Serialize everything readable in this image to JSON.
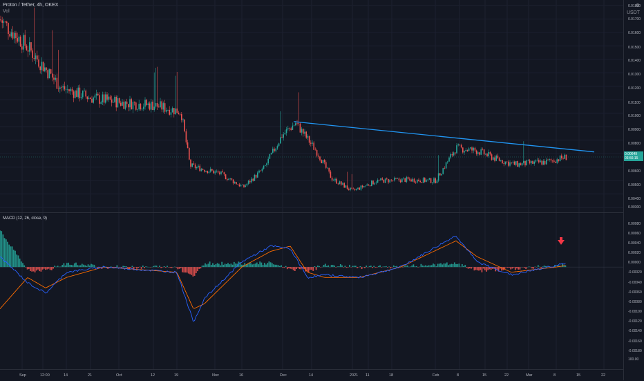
{
  "header": {
    "symbol": "Proton / Tether, 4h, OKEX",
    "vol_label": "Vol"
  },
  "corner_icons": [
    "settings-icon",
    "currency-label"
  ],
  "currency_label": "USDT",
  "macd": {
    "label": "MACD (12, 26, close, 9)"
  },
  "price_axis": {
    "ticks": [
      "0.01800",
      "0.01700",
      "0.01600",
      "0.01500",
      "0.01400",
      "0.01300",
      "0.01200",
      "0.01100",
      "0.01000",
      "0.00900",
      "0.00800",
      "0.00700",
      "0.00600",
      "0.00500",
      "0.00400",
      "0.00300"
    ],
    "last_price": "0.00649",
    "countdown": "03:56:15"
  },
  "macd_axis": {
    "ticks": [
      "0.00080",
      "0.00060",
      "0.00040",
      "0.00020",
      "0.00000",
      "-0.00020",
      "-0.00040",
      "-0.00060",
      "-0.00080",
      "-0.00100",
      "-0.00120",
      "-0.00140",
      "-0.00160",
      "-0.00180",
      "100.00"
    ]
  },
  "time_axis": {
    "ticks": [
      "Sep",
      "12:00",
      "14",
      "21",
      "Oct",
      "12",
      "19",
      "Nov",
      "16",
      "Dec",
      "14",
      "2021",
      "11",
      "18",
      "Feb",
      "8",
      "15",
      "22",
      "Mar",
      "8",
      "15",
      "22"
    ]
  },
  "colors": {
    "background": "#131722",
    "up": "#26a69a",
    "down": "#ef5350",
    "trendline": "#2196f3",
    "macd_line": "#2962ff",
    "signal_line": "#ff6d00",
    "arrow": "#f23645"
  },
  "chart_data": {
    "type": "candlestick",
    "title": "Proton / Tether, 4h, OKEX",
    "price_range": [
      0.0025,
      0.0185
    ],
    "price_path": [
      {
        "x": "Aug 28",
        "close": 0.0174
      },
      {
        "x": "Sep 5",
        "close": 0.0152
      },
      {
        "x": "Sep 12",
        "close": 0.012
      },
      {
        "x": "Sep 21",
        "close": 0.0112
      },
      {
        "x": "Oct 1",
        "close": 0.0108
      },
      {
        "x": "Oct 12",
        "close": 0.0106
      },
      {
        "x": "Oct 19",
        "close": 0.0101
      },
      {
        "x": "Oct 24",
        "close": 0.0058
      },
      {
        "x": "Nov 1",
        "close": 0.0052
      },
      {
        "x": "Nov 10",
        "close": 0.0041
      },
      {
        "x": "Nov 20",
        "close": 0.0056
      },
      {
        "x": "Nov 30",
        "close": 0.0082
      },
      {
        "x": "Dec 3",
        "close": 0.0092
      },
      {
        "x": "Dec 14",
        "close": 0.0068
      },
      {
        "x": "Dec 25",
        "close": 0.0048
      },
      {
        "x": "Jan 4",
        "close": 0.0038
      },
      {
        "x": "Jan 14",
        "close": 0.0046
      },
      {
        "x": "Jan 25",
        "close": 0.0047
      },
      {
        "x": "Feb 1",
        "close": 0.0046
      },
      {
        "x": "Feb 8",
        "close": 0.0072
      },
      {
        "x": "Feb 15",
        "close": 0.007
      },
      {
        "x": "Feb 22",
        "close": 0.0063
      },
      {
        "x": "Mar 1",
        "close": 0.0059
      },
      {
        "x": "Mar 8",
        "close": 0.0061
      },
      {
        "x": "Mar 10",
        "close": 0.0065
      }
    ],
    "trendline": {
      "start": {
        "x": "Dec 3",
        "price": 0.0093
      },
      "end": {
        "x": "Mar 18",
        "price": 0.0069
      }
    },
    "macd_range": [
      -0.0019,
      0.0009
    ],
    "macd_path": [
      {
        "x": "Aug 28",
        "macd": 0.0002,
        "signal": -0.0008
      },
      {
        "x": "Sep 5",
        "macd": -0.0003,
        "signal": -0.0002
      },
      {
        "x": "Sep 14",
        "macd": -0.0005,
        "signal": -0.0004
      },
      {
        "x": "Sep 21",
        "macd": -0.0001,
        "signal": -0.0002
      },
      {
        "x": "Oct 1",
        "macd": 0.0,
        "signal": 0.0
      },
      {
        "x": "Oct 19",
        "macd": -0.0001,
        "signal": -0.0001
      },
      {
        "x": "Oct 24",
        "macd": -0.00105,
        "signal": -0.0008
      },
      {
        "x": "Nov 1",
        "macd": -0.0006,
        "signal": -0.0007
      },
      {
        "x": "Nov 16",
        "macd": 0.0001,
        "signal": 0.0
      },
      {
        "x": "Nov 30",
        "macd": 0.0004,
        "signal": 0.0003
      },
      {
        "x": "Dec 6",
        "macd": 0.00035,
        "signal": 0.0004
      },
      {
        "x": "Dec 14",
        "macd": -0.0002,
        "signal": -0.0001
      },
      {
        "x": "Dec 25",
        "macd": -0.00015,
        "signal": -0.0002
      },
      {
        "x": "Jan 11",
        "macd": -0.0002,
        "signal": -0.0002
      },
      {
        "x": "Jan 25",
        "macd": 0.0,
        "signal": 0.0
      },
      {
        "x": "Feb 8",
        "macd": 0.0006,
        "signal": 0.0005
      },
      {
        "x": "Feb 15",
        "macd": 0.0001,
        "signal": 0.0002
      },
      {
        "x": "Feb 28",
        "macd": -0.00015,
        "signal": -0.0001
      },
      {
        "x": "Mar 8",
        "macd": 3e-05,
        "signal": 0.0
      },
      {
        "x": "Mar 10",
        "macd": 8e-05,
        "signal": 3e-05
      }
    ]
  }
}
